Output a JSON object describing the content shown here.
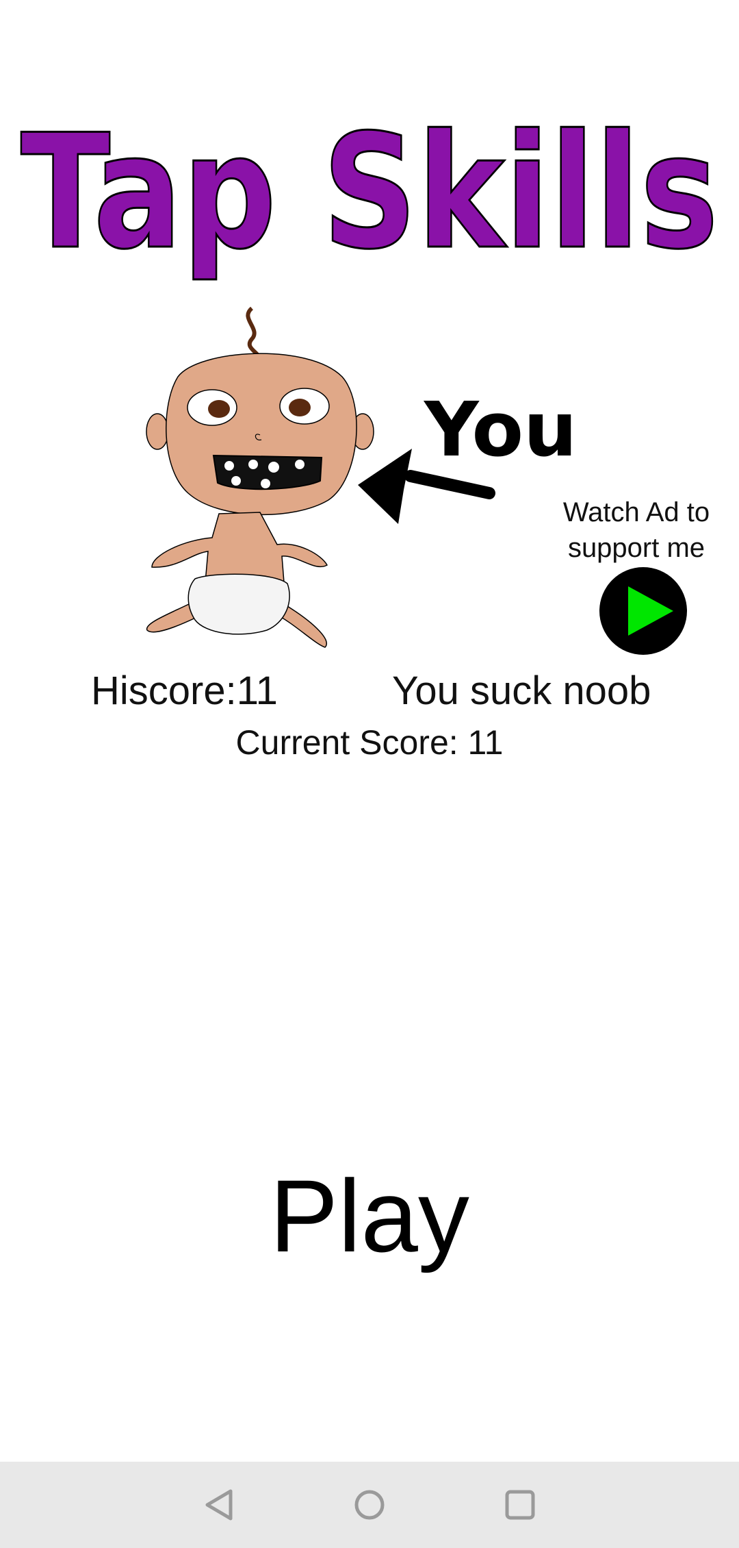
{
  "logo": {
    "text": "Tap Skills",
    "color": "#8a12a8"
  },
  "character": {
    "pointer_text": "You"
  },
  "ad": {
    "text": "Watch Ad to\nsupport me",
    "icon": "play-icon",
    "icon_color": "#00e600"
  },
  "scores": {
    "hiscore": "Hiscore:11",
    "taunt": "You suck noob",
    "current": "Current Score: 11"
  },
  "play": {
    "label": "Play"
  },
  "nav": {
    "back_icon": "back-triangle-icon",
    "home_icon": "home-circle-icon",
    "recents_icon": "recents-square-icon"
  }
}
